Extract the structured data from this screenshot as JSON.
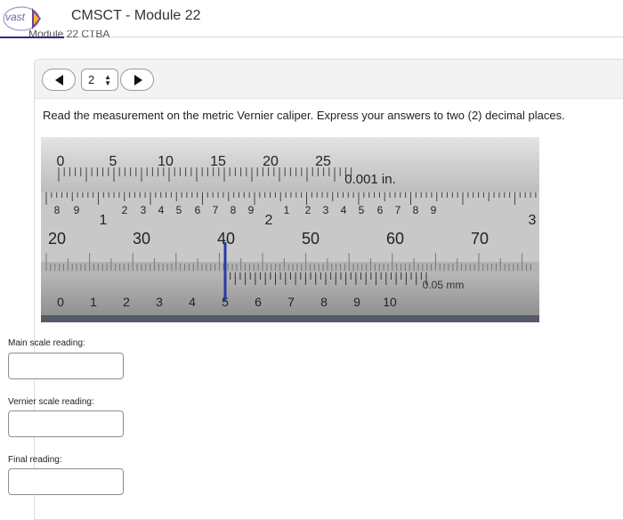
{
  "header": {
    "logo_text": "vast",
    "title": "CMSCT - Module 22",
    "subtitle": "Module 22 CTBA"
  },
  "nav": {
    "current_page": "2"
  },
  "question": {
    "prompt": "Read the measurement on the metric Vernier caliper. Express your answers to two (2) decimal places."
  },
  "caliper": {
    "inch_main_labels": [
      "0",
      "5",
      "10",
      "15",
      "20",
      "25"
    ],
    "inch_vernier_label": "0.001 in.",
    "inch_scale_upper_digits": [
      "8",
      "9",
      "1",
      "2",
      "3",
      "4",
      "5",
      "6",
      "7",
      "8",
      "9",
      "2",
      "1",
      "2",
      "3",
      "4",
      "5",
      "6",
      "7",
      "8",
      "9",
      "3"
    ],
    "metric_main_labels": [
      "20",
      "30",
      "40",
      "50",
      "60",
      "70"
    ],
    "metric_vernier_label": "0.05 mm",
    "metric_vernier_digits": [
      "0",
      "1",
      "2",
      "3",
      "4",
      "5",
      "6",
      "7",
      "8",
      "9",
      "10"
    ]
  },
  "fields": {
    "main_scale_label": "Main scale reading:",
    "main_scale_value": "",
    "vernier_scale_label": "Vernier scale reading:",
    "vernier_scale_value": "",
    "final_reading_label": "Final reading:",
    "final_reading_value": ""
  },
  "colors": {
    "accent": "#2b2b8a",
    "caliper_steel": "#c9c9c9",
    "caliper_dark": "#8f8f8f",
    "zero_marker": "#2a3aa8"
  },
  "icons": {
    "prev": "triangle-left-icon",
    "next": "triangle-right-icon",
    "select_arrows": "up-down-arrows-icon"
  }
}
